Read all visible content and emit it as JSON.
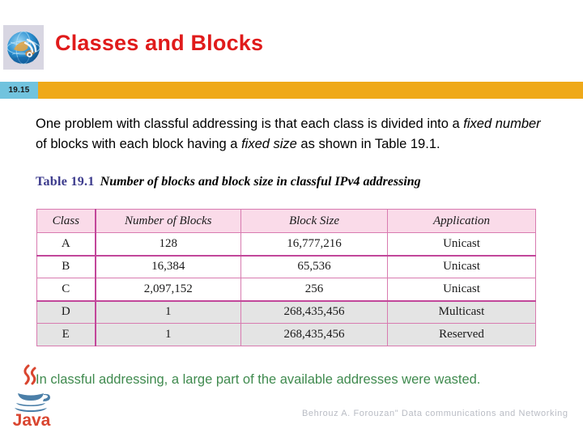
{
  "header": {
    "title": "Classes and Blocks",
    "title_color": "#e01b1b",
    "logo_icon": "globe-network-icon"
  },
  "number_bar": {
    "slide_number": "19.15",
    "badge_color": "#71c3de",
    "bar_color": "#efa919"
  },
  "intro": {
    "part1": "One problem with classful addressing is that each class is divided into a ",
    "italic1": "fixed number",
    "part2": " of blocks with each block having a ",
    "italic2": "fixed size",
    "part3": " as shown in Table 19.1."
  },
  "table_caption": {
    "label": "Table 19.1",
    "text": "Number of blocks and block size in classful IPv4 addressing",
    "label_color": "#3b3a8c"
  },
  "table": {
    "header_bg": "#fadbe9",
    "border_color": "#d87bb0",
    "columns": [
      "Class",
      "Number of Blocks",
      "Block Size",
      "Application"
    ],
    "rows": [
      {
        "class": "A",
        "blocks": "128",
        "size": "16,777,216",
        "application": "Unicast",
        "shaded": false
      },
      {
        "class": "B",
        "blocks": "16,384",
        "size": "65,536",
        "application": "Unicast",
        "shaded": false
      },
      {
        "class": "C",
        "blocks": "2,097,152",
        "size": "256",
        "application": "Unicast",
        "shaded": false
      },
      {
        "class": "D",
        "blocks": "1",
        "size": "268,435,456",
        "application": "Multicast",
        "shaded": true
      },
      {
        "class": "E",
        "blocks": "1",
        "size": "268,435,456",
        "application": "Reserved",
        "shaded": true
      }
    ]
  },
  "footnote": {
    "text": "In classful addressing, a large part of the available addresses were wasted.",
    "color": "#3f8a4e"
  },
  "java_logo": {
    "icon": "java-coffee-cup-icon",
    "wordmark": "Java"
  },
  "footer": {
    "credit": "Behrouz A. Forouzan\" Data communications and Networking"
  }
}
